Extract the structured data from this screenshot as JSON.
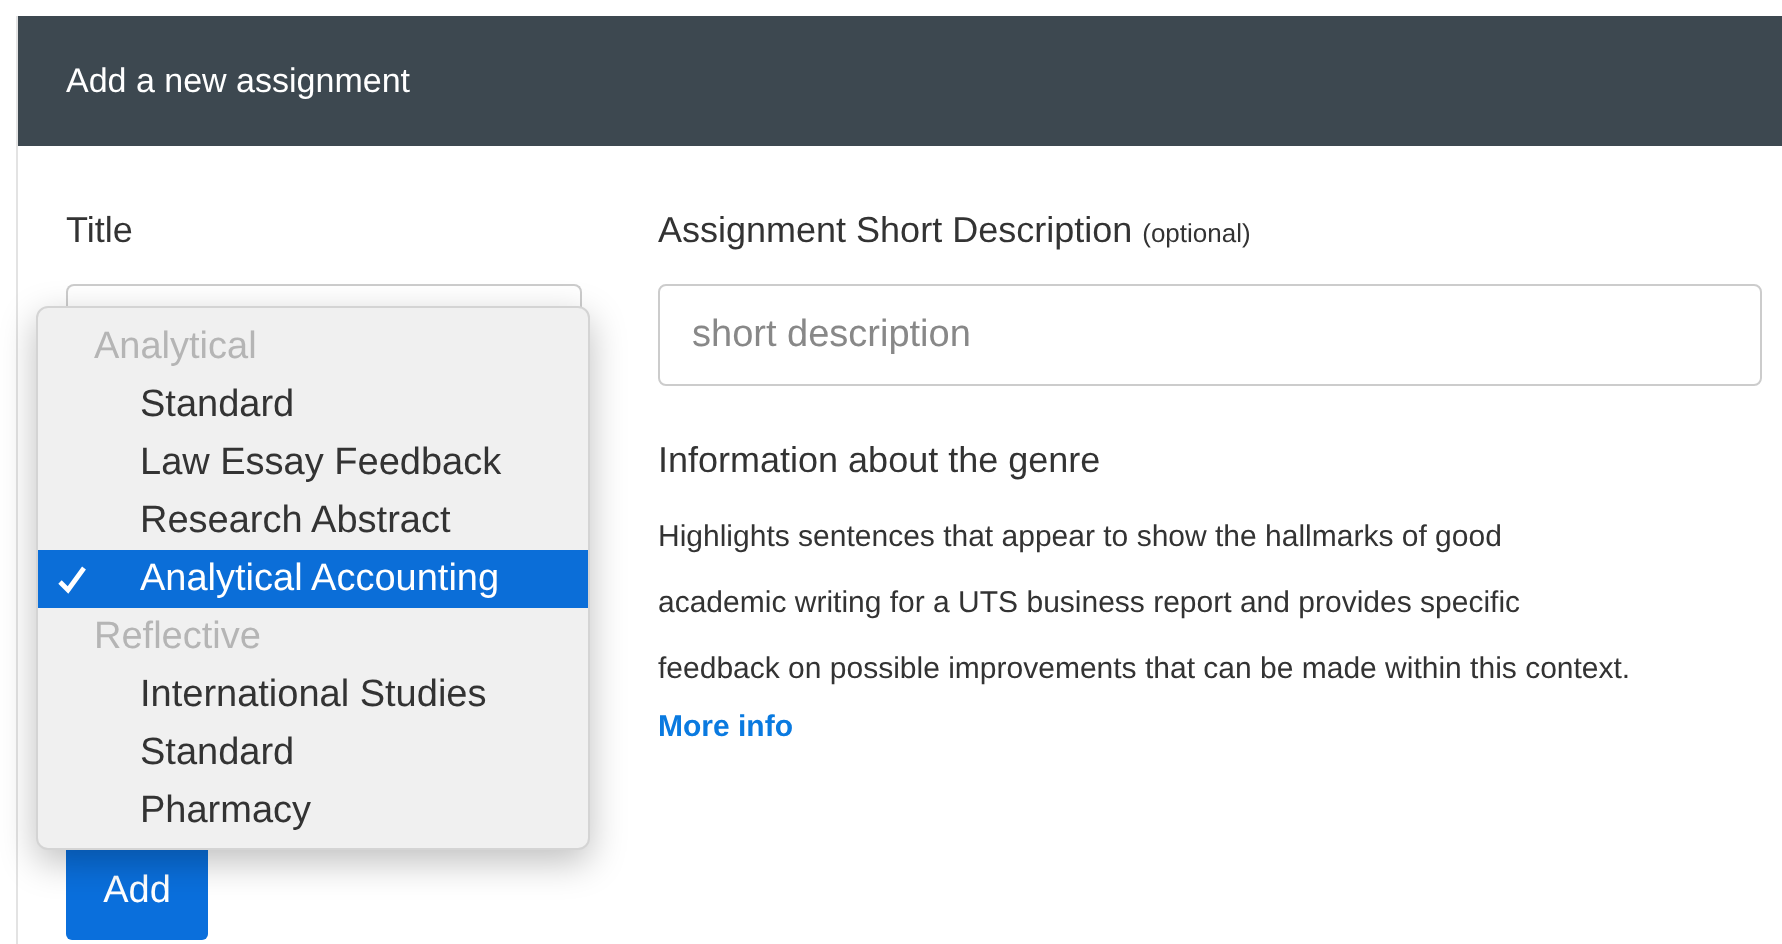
{
  "panel": {
    "title": "Add a new assignment"
  },
  "title_field": {
    "label": "Title"
  },
  "description_field": {
    "label": "Assignment Short Description",
    "label_note": "(optional)",
    "placeholder": "short description"
  },
  "genre_info": {
    "heading": "Information about the genre",
    "text_lines": [
      "Highlights sentences that appear to show the hallmarks of good",
      "academic writing for a UTS business report and provides specific",
      "feedback on possible improvements that can be made within this context."
    ],
    "link": "More info"
  },
  "dropdown": {
    "items": [
      {
        "kind": "group",
        "label": "Analytical"
      },
      {
        "kind": "option",
        "label": "Standard",
        "selected": false
      },
      {
        "kind": "option",
        "label": "Law Essay Feedback",
        "selected": false
      },
      {
        "kind": "option",
        "label": "Research Abstract",
        "selected": false
      },
      {
        "kind": "option",
        "label": "Analytical Accounting",
        "selected": true
      },
      {
        "kind": "group",
        "label": "Reflective"
      },
      {
        "kind": "option",
        "label": "International Studies",
        "selected": false
      },
      {
        "kind": "option",
        "label": "Standard",
        "selected": false
      },
      {
        "kind": "option",
        "label": "Pharmacy",
        "selected": false
      }
    ]
  },
  "add_button": "Add"
}
